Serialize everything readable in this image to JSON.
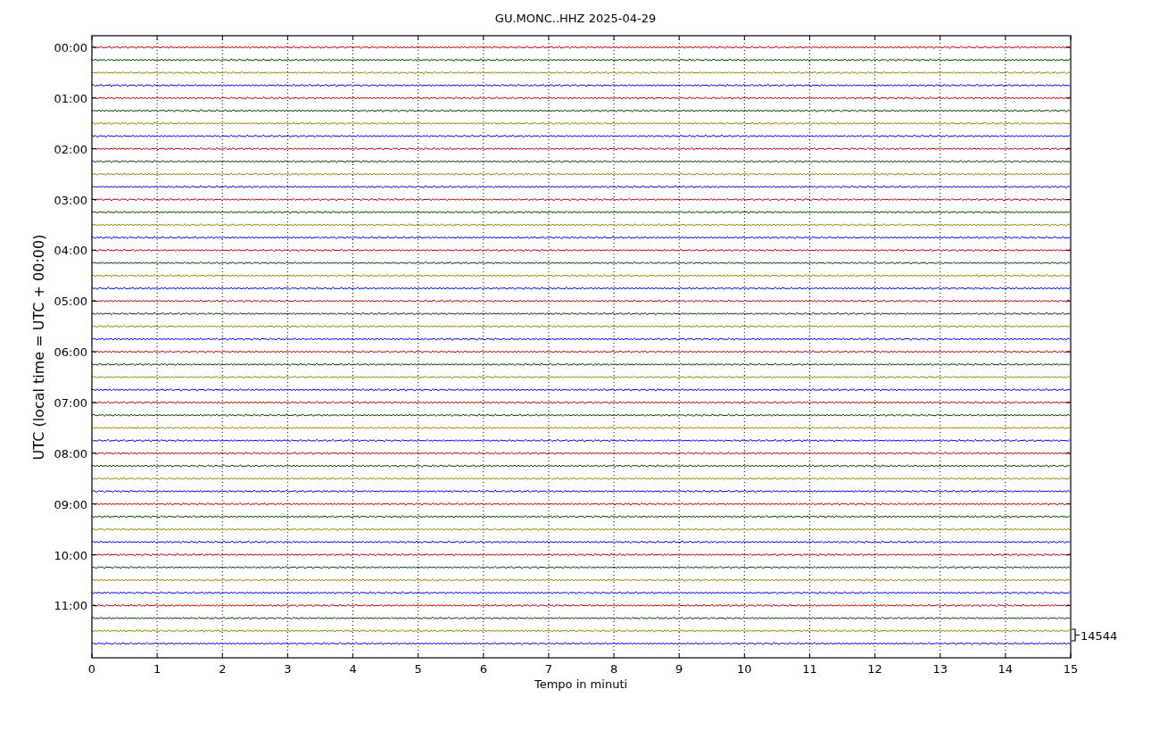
{
  "title": "GU.MONC..HHZ 2025-04-29",
  "ylabel": "UTC (local time = UTC + 00:00)",
  "xlabel": "Tempo in minuti",
  "yticks": [
    "00:00",
    "01:00",
    "02:00",
    "03:00",
    "04:00",
    "05:00",
    "06:00",
    "07:00",
    "08:00",
    "09:00",
    "10:00",
    "11:00"
  ],
  "xticks": [
    "0",
    "1",
    "2",
    "3",
    "4",
    "5",
    "6",
    "7",
    "8",
    "9",
    "10",
    "11",
    "12",
    "13",
    "14",
    "15"
  ],
  "scale_label": "14544",
  "traces": [
    {
      "color": "#c00000"
    },
    {
      "color": "#004000"
    },
    {
      "color": "#a08000"
    },
    {
      "color": "#0000ff"
    },
    {
      "color": "#c00000"
    },
    {
      "color": "#004000"
    },
    {
      "color": "#a08000"
    },
    {
      "color": "#0000ff"
    },
    {
      "color": "#c00000"
    },
    {
      "color": "#004000"
    },
    {
      "color": "#a08000"
    },
    {
      "color": "#0000ff"
    },
    {
      "color": "#c00000"
    },
    {
      "color": "#004000"
    },
    {
      "color": "#a08000"
    },
    {
      "color": "#0000ff"
    },
    {
      "color": "#c00000"
    },
    {
      "color": "#004000"
    },
    {
      "color": "#a08000"
    },
    {
      "color": "#0000ff"
    },
    {
      "color": "#c00000"
    },
    {
      "color": "#004000"
    },
    {
      "color": "#a08000"
    },
    {
      "color": "#0000ff"
    },
    {
      "color": "#c00000"
    },
    {
      "color": "#004000"
    },
    {
      "color": "#a08000"
    },
    {
      "color": "#0000ff"
    },
    {
      "color": "#c00000"
    },
    {
      "color": "#004000"
    },
    {
      "color": "#a08000"
    },
    {
      "color": "#0000ff"
    },
    {
      "color": "#c00000"
    },
    {
      "color": "#004000"
    },
    {
      "color": "#a08000"
    },
    {
      "color": "#0000ff"
    },
    {
      "color": "#c00000"
    },
    {
      "color": "#004000"
    },
    {
      "color": "#a08000"
    },
    {
      "color": "#0000ff"
    },
    {
      "color": "#c00000"
    },
    {
      "color": "#004000"
    },
    {
      "color": "#a08000"
    },
    {
      "color": "#0000ff"
    },
    {
      "color": "#c00000"
    },
    {
      "color": "#004000"
    },
    {
      "color": "#a08000"
    },
    {
      "color": "#0000ff"
    }
  ]
}
